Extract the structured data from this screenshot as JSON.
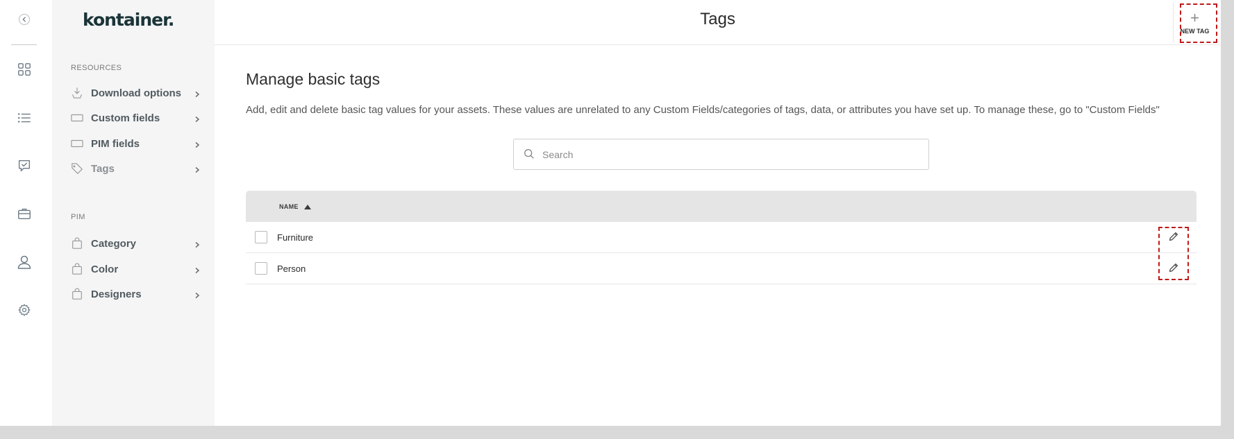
{
  "logo": "kontainer.",
  "header": {
    "title": "Tags",
    "new_tag_label": "NEW TAG"
  },
  "sidebar": {
    "resources_label": "RESOURCES",
    "resources_items": [
      {
        "label": "Download options",
        "icon": "download-icon"
      },
      {
        "label": "Custom fields",
        "icon": "field-icon"
      },
      {
        "label": "PIM fields",
        "icon": "field-icon"
      },
      {
        "label": "Tags",
        "icon": "tag-icon"
      }
    ],
    "pim_label": "PIM",
    "pim_items": [
      {
        "label": "Category",
        "icon": "bag-icon"
      },
      {
        "label": "Color",
        "icon": "bag-icon"
      },
      {
        "label": "Designers",
        "icon": "bag-icon"
      }
    ]
  },
  "rail": [
    {
      "icon": "collapse-icon"
    },
    {
      "icon": "dashboard-icon"
    },
    {
      "icon": "list-icon"
    },
    {
      "icon": "approval-icon"
    },
    {
      "icon": "briefcase-icon"
    },
    {
      "icon": "user-icon"
    },
    {
      "icon": "settings-icon"
    }
  ],
  "main": {
    "heading": "Manage basic tags",
    "description": "Add, edit and delete basic tag values for your assets. These values are unrelated to any Custom Fields/categories of tags, data, or attributes you have set up. To manage these, go to \"Custom Fields\"",
    "search_placeholder": "Search",
    "table": {
      "column_name": "NAME",
      "sort": "ascending",
      "rows": [
        {
          "name": "Furniture"
        },
        {
          "name": "Person"
        }
      ]
    }
  },
  "colors": {
    "highlight": "#c01818",
    "sidebar_bg": "#f5f5f5",
    "frame": "#d9d9d9"
  }
}
